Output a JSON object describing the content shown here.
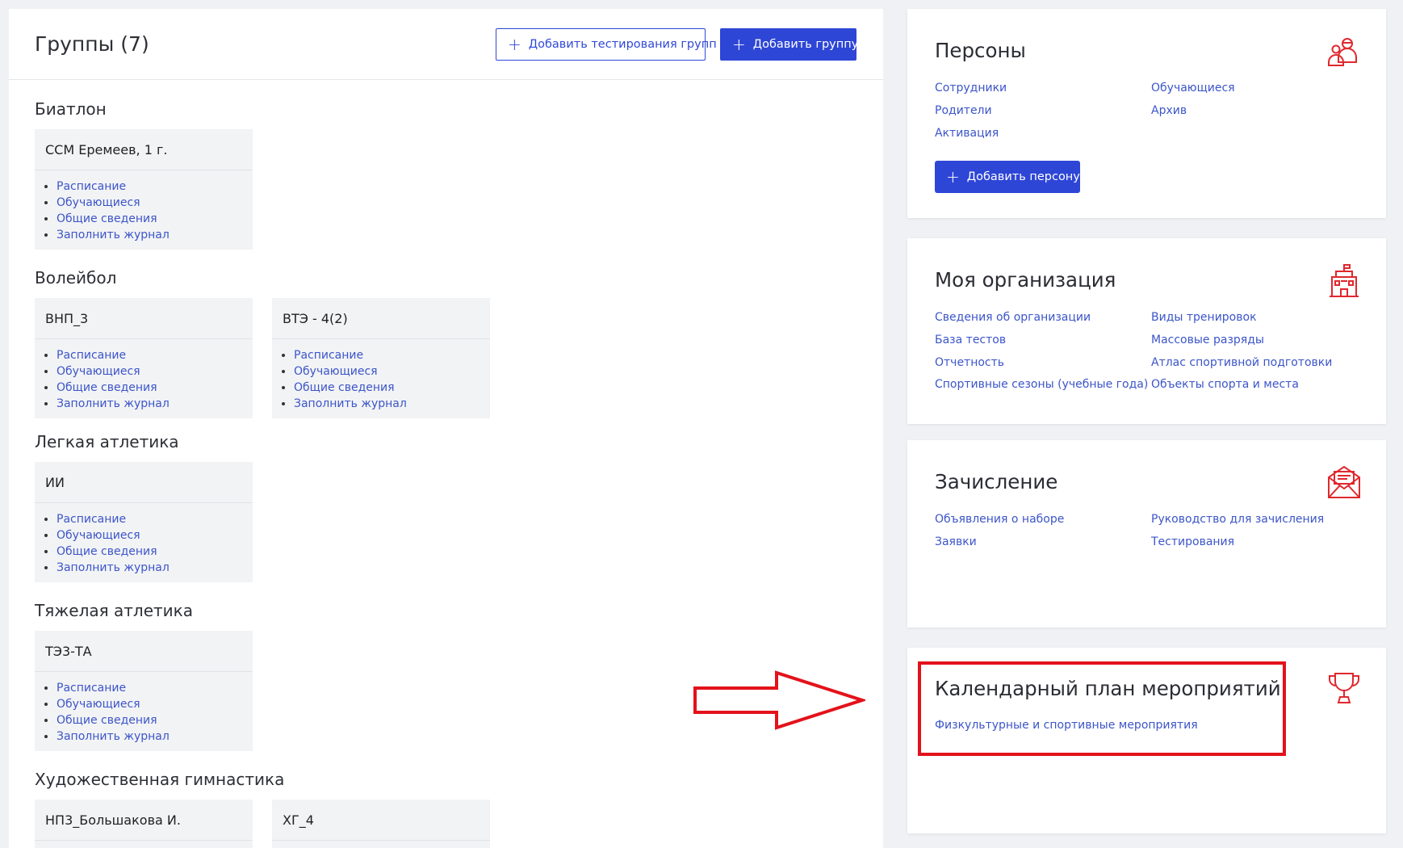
{
  "groups_panel": {
    "title": "Группы (7)",
    "add_test_groups_label": "Добавить тестирования групп",
    "add_group_label": "Добавить группу",
    "sports": [
      {
        "name": "Биатлон",
        "groups": [
          {
            "name": "ССМ Еремеев, 1 г.",
            "links": [
              "Расписание",
              "Обучающиеся",
              "Общие сведения",
              "Заполнить журнал"
            ]
          }
        ]
      },
      {
        "name": "Волейбол",
        "groups": [
          {
            "name": "ВНП_3",
            "links": [
              "Расписание",
              "Обучающиеся",
              "Общие сведения",
              "Заполнить журнал"
            ]
          },
          {
            "name": "ВТЭ - 4(2)",
            "links": [
              "Расписание",
              "Обучающиеся",
              "Общие сведения",
              "Заполнить журнал"
            ]
          }
        ]
      },
      {
        "name": "Легкая атлетика",
        "groups": [
          {
            "name": "ИИ",
            "links": [
              "Расписание",
              "Обучающиеся",
              "Общие сведения",
              "Заполнить журнал"
            ]
          }
        ]
      },
      {
        "name": "Тяжелая атлетика",
        "groups": [
          {
            "name": "ТЭ3-ТА",
            "links": [
              "Расписание",
              "Обучающиеся",
              "Общие сведения",
              "Заполнить журнал"
            ]
          }
        ]
      },
      {
        "name": "Художественная гимнастика",
        "groups": [
          {
            "name": "НП3_Большакова И.",
            "links": []
          },
          {
            "name": "ХГ_4",
            "links": []
          }
        ]
      }
    ]
  },
  "persons": {
    "title": "Персоны",
    "icon": "people-icon",
    "links": [
      "Сотрудники",
      "Обучающиеся",
      "Родители",
      "Архив",
      "Активация"
    ],
    "add_person_label": "Добавить персону"
  },
  "organization": {
    "title": "Моя организация",
    "icon": "building-icon",
    "links": [
      "Сведения об организации",
      "Виды тренировок",
      "База тестов",
      "Массовые разряды",
      "Отчетность",
      "Атлас спортивной подготовки",
      "Спортивные сезоны (учебные года)",
      "Объекты спорта и места"
    ]
  },
  "enrollment": {
    "title": "Зачисление",
    "icon": "envelope-icon",
    "links": [
      "Объявления о наборе",
      "Руководство для зачисления",
      "Заявки",
      "Тестирования"
    ]
  },
  "calendar": {
    "title": "Календарный план мероприятий",
    "icon": "trophy-icon",
    "links": [
      "Физкультурные и спортивные мероприятия"
    ]
  },
  "colors": {
    "accent": "#2e46d6",
    "link": "#3c55c9",
    "icon_red": "#e0282e",
    "annotation_red": "#e3121b"
  }
}
